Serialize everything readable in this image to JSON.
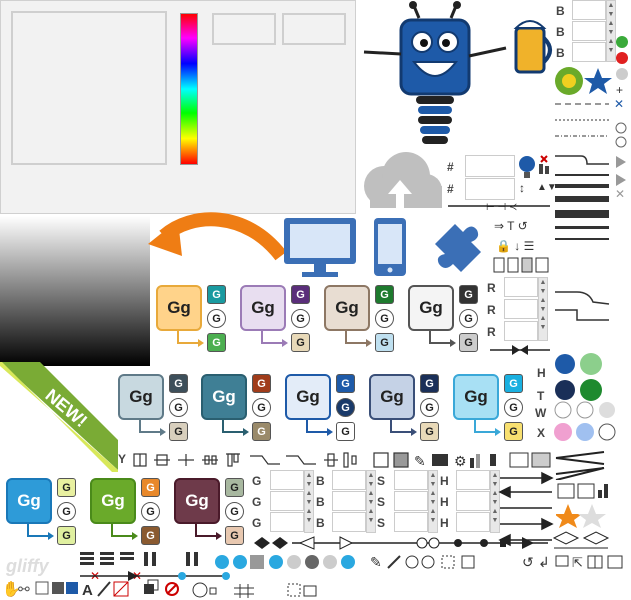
{
  "colors": {
    "panel_bg": "#f2f2f2",
    "arrow_orange": "#ef7d14",
    "robot_blue": "#1e5aa8",
    "device_blue": "#3b6fb6",
    "cloud_gray": "#bfbfbf",
    "ribbon_green": "#7aab35"
  },
  "ribbon": {
    "text": "NEW!"
  },
  "cards": [
    {
      "label": "Gg",
      "fill": "#ffd38a",
      "border": "#e8a93a",
      "chips": [
        "G",
        "G",
        "G"
      ],
      "chipColors": [
        "#1a9aa0",
        "#ffffff",
        "#4caf50"
      ]
    },
    {
      "label": "Gg",
      "fill": "#e8def0",
      "border": "#9b7bb6",
      "chips": [
        "G",
        "G",
        "G"
      ],
      "chipColors": [
        "#5a2e7a",
        "#ffffff",
        "#e8d9b8"
      ]
    },
    {
      "label": "Gg",
      "fill": "#e8ddd2",
      "border": "#8d7764",
      "chips": [
        "G",
        "G",
        "G"
      ],
      "chipColors": [
        "#1e7a2e",
        "#ffffff",
        "#bfe0f0"
      ]
    },
    {
      "label": "Gg",
      "fill": "#f4f4f4",
      "border": "#555555",
      "chips": [
        "G",
        "G",
        "G"
      ],
      "chipColors": [
        "#333333",
        "#ffffff",
        "#cccccc"
      ]
    },
    {
      "label": "Gg",
      "fill": "#c8d9e0",
      "border": "#5f7a88",
      "chips": [
        "G",
        "G",
        "G"
      ],
      "chipColors": [
        "#3d4f5a",
        "#ffffff",
        "#d8cfbd"
      ]
    },
    {
      "label": "Gg",
      "fill": "#3f7f95",
      "border": "#2a5f70",
      "chips": [
        "G",
        "G",
        "G"
      ],
      "chipColors": [
        "#a03c1a",
        "#ffffff",
        "#9a8a6a"
      ]
    },
    {
      "label": "Gg",
      "fill": "#e3ecf8",
      "border": "#1e5aa8",
      "chips": [
        "G",
        "G",
        "G"
      ],
      "chipColors": [
        "#1e5aa8",
        "#1a3a6a",
        "#ffffff"
      ]
    },
    {
      "label": "Gg",
      "fill": "#c5d2e6",
      "border": "#3a4f78",
      "chips": [
        "G",
        "G",
        "G"
      ],
      "chipColors": [
        "#1a2f58",
        "#ffffff",
        "#e8d9b8"
      ]
    },
    {
      "label": "Gg",
      "fill": "#a8e0f4",
      "border": "#3aa8d8",
      "chips": [
        "G",
        "G",
        "G"
      ],
      "chipColors": [
        "#1ab0e0",
        "#ffffff",
        "#f8e070"
      ]
    },
    {
      "label": "Gg",
      "fill": "#2e9bd8",
      "border": "#1a78b8",
      "chips": [
        "G",
        "G",
        "G"
      ],
      "chipColors": [
        "#e8f0a0",
        "#ffffff",
        "#e0f0a0"
      ]
    },
    {
      "label": "Gg",
      "fill": "#6aaa2a",
      "border": "#4a8a1a",
      "chips": [
        "G",
        "G",
        "G"
      ],
      "chipColors": [
        "#e8882a",
        "#ffffff",
        "#8a5a30"
      ]
    },
    {
      "label": "Gg",
      "fill": "#6e3a4a",
      "border": "#4a1a2a",
      "chips": [
        "G",
        "G",
        "G"
      ],
      "chipColors": [
        "#a8b8a0",
        "#ffffff",
        "#e8c8b0"
      ]
    }
  ],
  "labels": {
    "hash1": "#",
    "hash2": "#",
    "b1": "B",
    "b2": "B",
    "b3": "B",
    "r1": "R",
    "r2": "R",
    "r3": "R",
    "h": "H",
    "t": "T",
    "w": "W",
    "x": "X",
    "y": "Y",
    "T_label": "T",
    "G1": "G",
    "G2": "G",
    "G3": "G",
    "B4": "B",
    "B5": "B",
    "B6": "B",
    "S1": "S",
    "S2": "S",
    "S3": "S",
    "H1": "H",
    "H2": "H",
    "H3": "H",
    "brand": "gliffy"
  }
}
